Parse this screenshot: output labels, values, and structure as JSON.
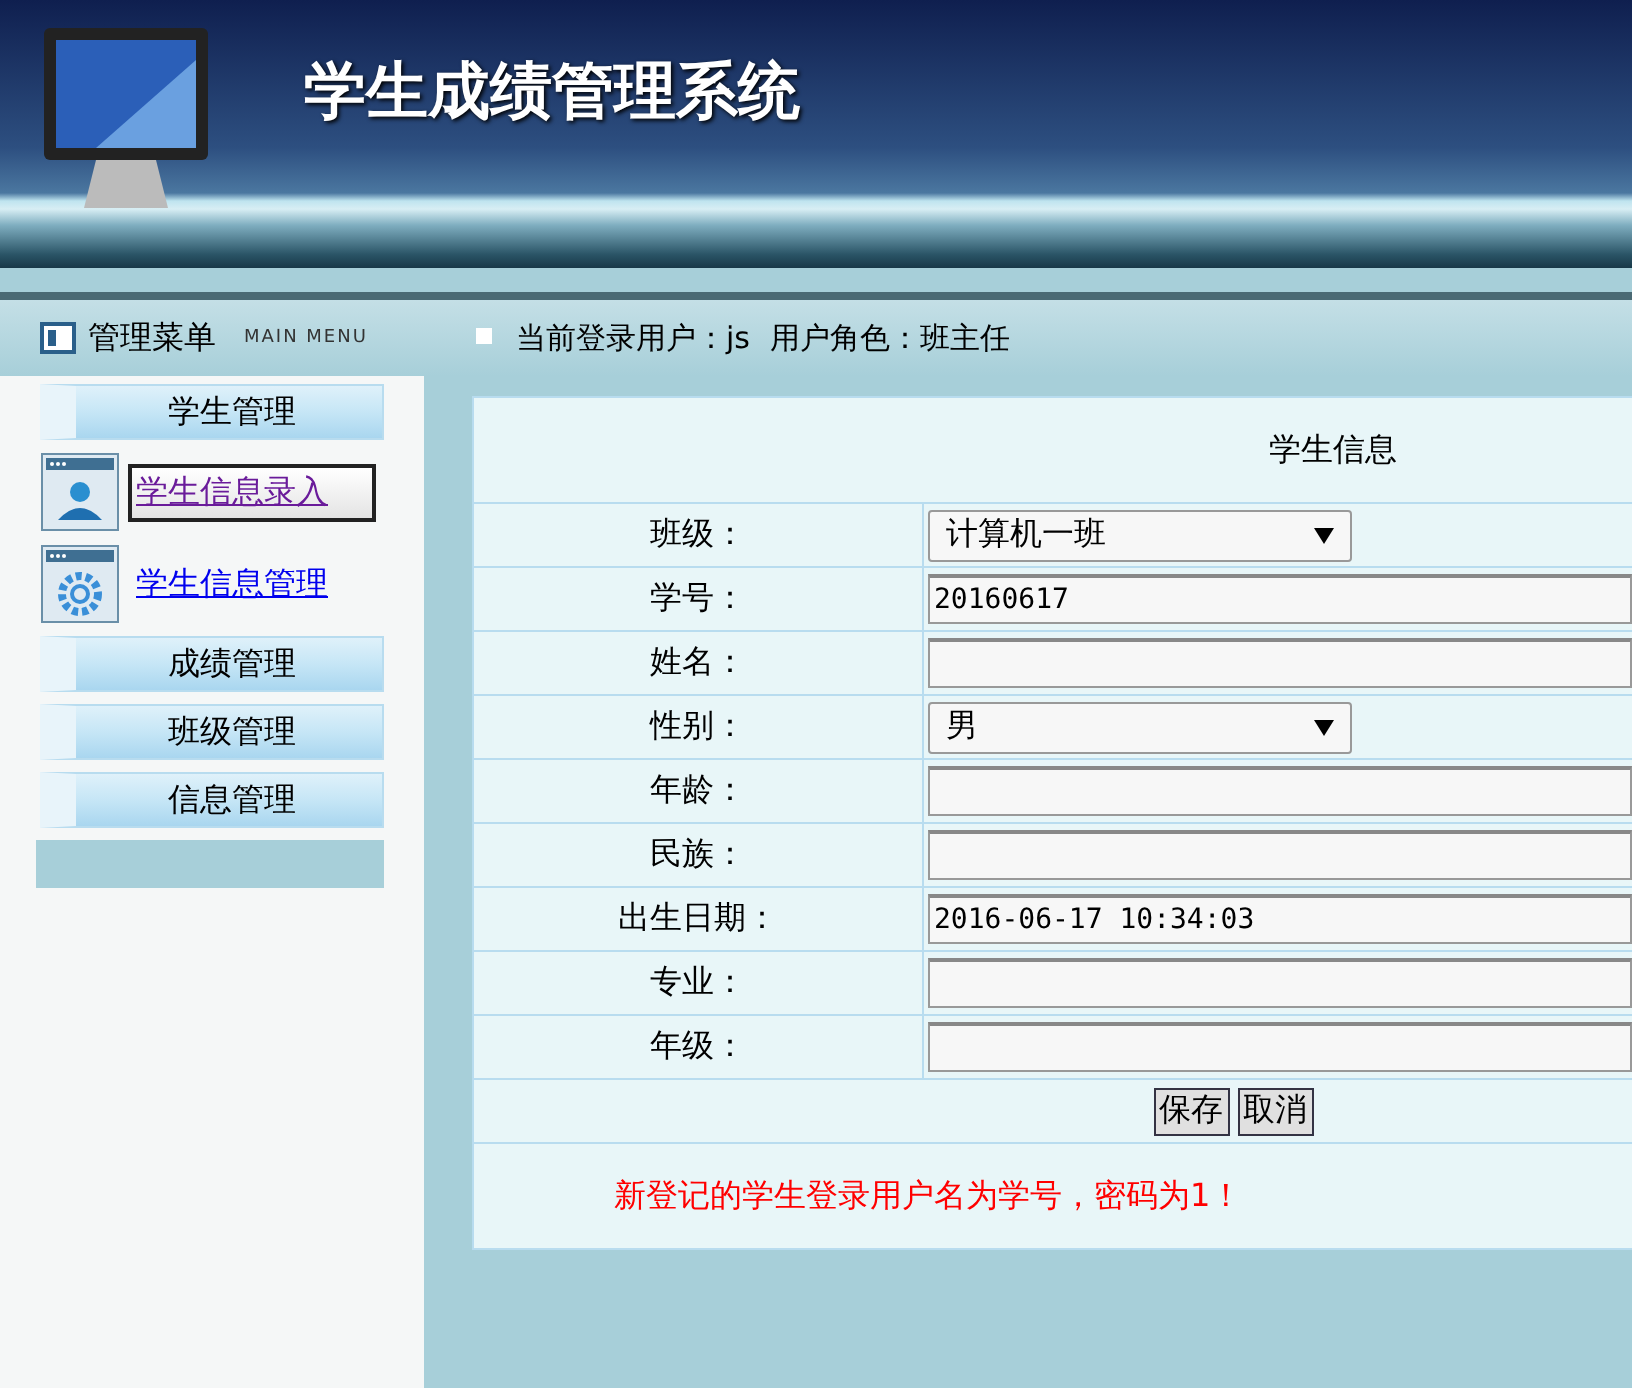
{
  "header": {
    "title": "学生成绩管理系统"
  },
  "menu": {
    "title": "管理菜单",
    "subtitle": "MAIN MENU",
    "groups": [
      {
        "label": "学生管理",
        "items": [
          {
            "label": "学生信息录入",
            "kind": "person",
            "selected": true
          },
          {
            "label": "学生信息管理",
            "kind": "gear",
            "selected": false
          }
        ]
      },
      {
        "label": "成绩管理"
      },
      {
        "label": "班级管理"
      },
      {
        "label": "信息管理"
      }
    ]
  },
  "user_bar": {
    "user": "当前登录用户：js",
    "role": "用户角色：班主任"
  },
  "form": {
    "title": "学生信息",
    "fields": [
      {
        "label": "班级：",
        "kind": "select",
        "value": "计算机一班"
      },
      {
        "label": "学号：",
        "kind": "text",
        "value": "20160617"
      },
      {
        "label": "姓名：",
        "kind": "text"
      },
      {
        "label": "性别：",
        "kind": "select",
        "value": "男"
      },
      {
        "label": "年龄：",
        "kind": "text"
      },
      {
        "label": "民族：",
        "kind": "text"
      },
      {
        "label": "出生日期：",
        "kind": "text",
        "value": "2016-06-17 10:34:03"
      },
      {
        "label": "专业：",
        "kind": "text"
      },
      {
        "label": "年级：",
        "kind": "text"
      }
    ],
    "buttons": [
      "保存",
      "取消"
    ],
    "notice": "新登记的学生登录用户名为学号，密码为1！"
  }
}
